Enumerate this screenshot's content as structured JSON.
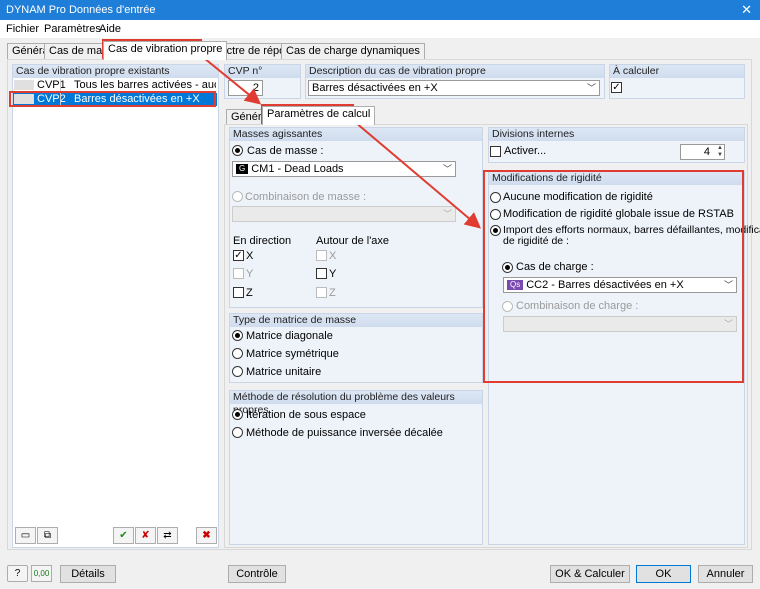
{
  "window": {
    "title": "DYNAM Pro Données d'entrée"
  },
  "menu": [
    "Fichier",
    "Paramètres",
    "Aide"
  ],
  "tabs": [
    "Général",
    "Cas de masse",
    "Cas de vibration propre",
    "Spectre de réponse",
    "Cas de charge dynamiques"
  ],
  "left": {
    "header": "Cas de vibration propre existants",
    "rows": [
      {
        "id": "CVP1",
        "desc": "Tous les barres activées - aucune mo"
      },
      {
        "id": "CVP2",
        "desc": "Barres désactivées en +X"
      }
    ]
  },
  "cvp": {
    "header": "CVP n°",
    "value": "2"
  },
  "description": {
    "header": "Description du cas de vibration propre",
    "value": "Barres désactivées en +X"
  },
  "acalc": {
    "header": "À calculer",
    "check": "✓"
  },
  "subtabs": [
    "Général",
    "Paramètres de calcul"
  ],
  "masses": {
    "header": "Masses agissantes",
    "cas_label": "Cas de masse :",
    "cas_badge": "G",
    "cas_value": "CM1 - Dead Loads",
    "comb_label": "Combinaison de masse :",
    "dir_label": "En direction",
    "axe_label": "Autour de l'axe",
    "x": "X",
    "y": "Y",
    "z": "Z",
    "check": "✓"
  },
  "matrice": {
    "header": "Type de matrice de masse",
    "options": [
      "Matrice diagonale",
      "Matrice symétrique",
      "Matrice unitaire"
    ]
  },
  "methode": {
    "header": "Méthode de résolution du problème des valeurs propres",
    "options": [
      "Itération de sous espace",
      "Méthode de puissance inversée décalée"
    ]
  },
  "divisions": {
    "header": "Divisions internes",
    "activer": "Activer...",
    "value": "4"
  },
  "rigidite": {
    "header": "Modifications de rigidité",
    "opt1": "Aucune modification de rigidité",
    "opt2": "Modification de rigidité globale issue de RSTAB",
    "opt3_line1": "Import des efforts normaux, barres défaillantes, modifications",
    "opt3_line2": "de rigidité de :",
    "cas_label": "Cas de charge :",
    "cas_badge": "Qs",
    "cas_value": "CC2 - Barres désactivées en +X",
    "comb_label": "Combinaison de charge :"
  },
  "left_tools": [
    "new-icon",
    "copy-icon",
    "check-all-icon",
    "uncheck-all-icon",
    "swap-icon",
    "delete-icon"
  ],
  "footer": {
    "details": "Détails",
    "controle": "Contrôle",
    "ok_calc": "OK & Calculer",
    "ok": "OK",
    "annuler": "Annuler",
    "zero": "0,00"
  },
  "colors": {
    "title_bar": "#1f7fd8",
    "selection": "#0078d7",
    "highlight": "#e03c31"
  }
}
